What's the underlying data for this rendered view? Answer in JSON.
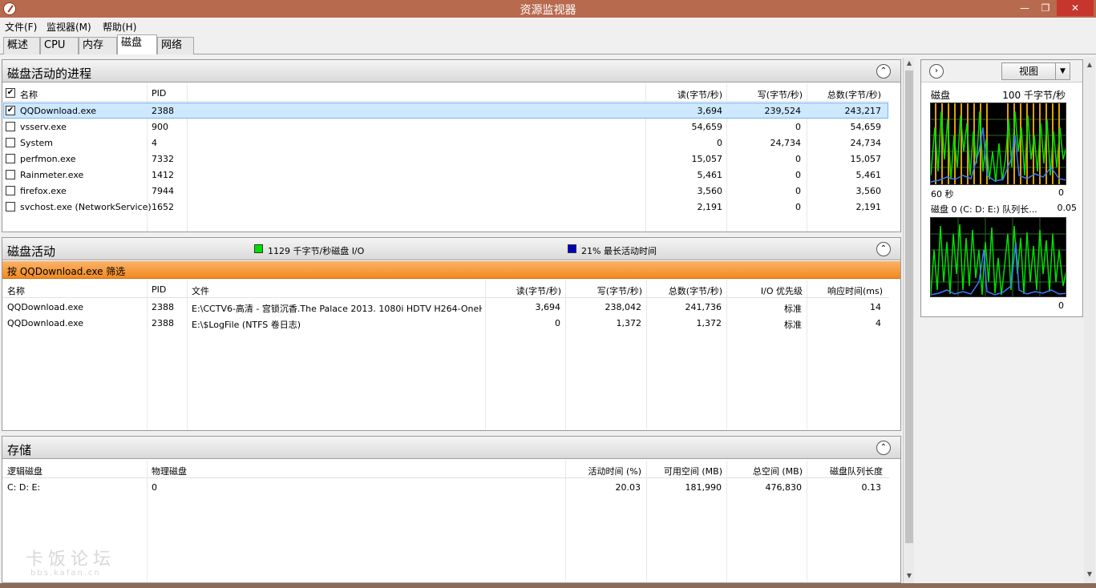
{
  "window": {
    "title": "资源监视器",
    "minimize": "—",
    "maximize": "❐",
    "close": "✕"
  },
  "menu": [
    "文件(F)",
    "监视器(M)",
    "帮助(H)"
  ],
  "tabs": [
    "概述",
    "CPU",
    "内存",
    "磁盘",
    "网络"
  ],
  "active_tab": "磁盘",
  "processes": {
    "title": "磁盘活动的进程",
    "headers": {
      "name": "名称",
      "pid": "PID",
      "read": "读(字节/秒)",
      "write": "写(字节/秒)",
      "total": "总数(字节/秒)"
    },
    "rows": [
      {
        "checked": true,
        "name": "QQDownload.exe",
        "pid": "2388",
        "read": "3,694",
        "write": "239,524",
        "total": "243,217"
      },
      {
        "checked": false,
        "name": "vsserv.exe",
        "pid": "900",
        "read": "54,659",
        "write": "0",
        "total": "54,659"
      },
      {
        "checked": false,
        "name": "System",
        "pid": "4",
        "read": "0",
        "write": "24,734",
        "total": "24,734"
      },
      {
        "checked": false,
        "name": "perfmon.exe",
        "pid": "7332",
        "read": "15,057",
        "write": "0",
        "total": "15,057"
      },
      {
        "checked": false,
        "name": "Rainmeter.exe",
        "pid": "1412",
        "read": "5,461",
        "write": "0",
        "total": "5,461"
      },
      {
        "checked": false,
        "name": "firefox.exe",
        "pid": "7944",
        "read": "3,560",
        "write": "0",
        "total": "3,560"
      },
      {
        "checked": false,
        "name": "svchost.exe (NetworkService)",
        "pid": "1652",
        "read": "2,191",
        "write": "0",
        "total": "2,191"
      }
    ]
  },
  "disk_activity": {
    "title": "磁盘活动",
    "legend_io": "1129 千字节/秒磁盘 I/O",
    "legend_active": "21% 最长活动时间",
    "io_color": "#00e000",
    "active_color": "#0000c0",
    "filter": "按 QQDownload.exe 筛选",
    "headers": {
      "name": "名称",
      "pid": "PID",
      "file": "文件",
      "read": "读(字节/秒)",
      "write": "写(字节/秒)",
      "total": "总数(字节/秒)",
      "priority": "I/O 优先级",
      "response": "响应时间(ms)"
    },
    "rows": [
      {
        "name": "QQDownload.exe",
        "pid": "2388",
        "file": "E:\\CCTV6-高清 - 宫锁沉香.The Palace 2013. 1080i HDTV H264-OneH...",
        "read": "3,694",
        "write": "238,042",
        "total": "241,736",
        "priority": "标准",
        "response": "14"
      },
      {
        "name": "QQDownload.exe",
        "pid": "2388",
        "file": "E:\\$LogFile (NTFS 卷日志)",
        "read": "0",
        "write": "1,372",
        "total": "1,372",
        "priority": "标准",
        "response": "4"
      }
    ]
  },
  "storage": {
    "title": "存储",
    "headers": {
      "logical": "逻辑磁盘",
      "physical": "物理磁盘",
      "active": "活动时间 (%)",
      "free": "可用空间 (MB)",
      "total": "总空间 (MB)",
      "queue": "磁盘队列长度"
    },
    "rows": [
      {
        "logical": "C: D: E:",
        "physical": "0",
        "active": "20.03",
        "free": "181,990",
        "total": "476,830",
        "queue": "0.13"
      }
    ]
  },
  "side": {
    "expand_icon": "›",
    "view_label": "视图",
    "graph1": {
      "label": "磁盘",
      "scale": "100 千字节/秒",
      "time": "60 秒",
      "min": "0"
    },
    "graph2": {
      "label": "磁盘 0 (C: D: E:) 队列长...",
      "scale": "0.05",
      "min": "0"
    }
  },
  "watermark": {
    "title": "卡饭论坛",
    "url": "bbs.kafan.cn"
  }
}
